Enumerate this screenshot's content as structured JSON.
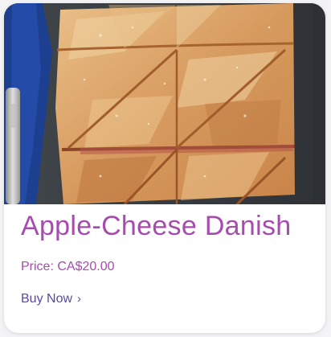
{
  "product": {
    "image_alt": "Apple-Cheese Danish",
    "title": "Apple-Cheese Danish",
    "price": "Price: CA$20.00",
    "buy_label": "Buy Now",
    "buy_icon": "chevron-right-icon"
  },
  "colors": {
    "title": "#a64cae",
    "price": "#a64cae",
    "link": "#5a4a9e",
    "card_bg": "#ffffff",
    "page_bg": "#f3f3f5"
  }
}
